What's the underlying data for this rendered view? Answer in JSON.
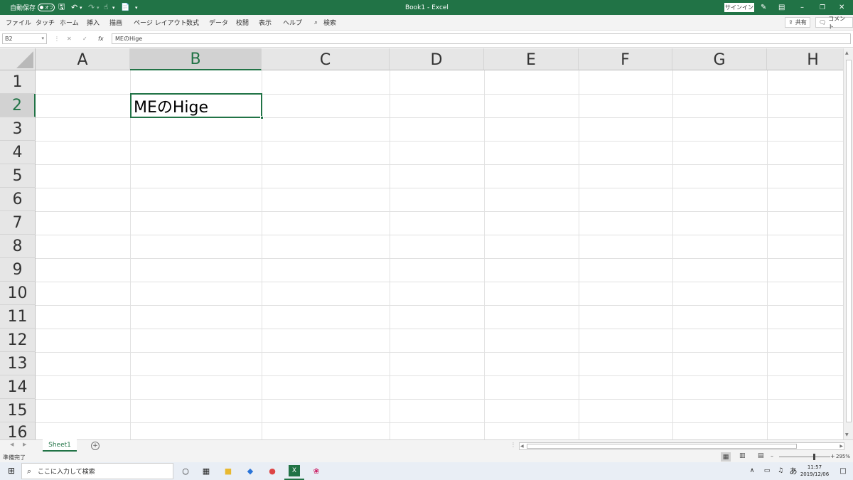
{
  "titlebar": {
    "autosave_label": "自動保存",
    "autosave_state": "オフ",
    "title": "Book1  -  Excel",
    "signin_label": "サインイン"
  },
  "ribbon": {
    "tabs": [
      "ファイル",
      "タッチ",
      "ホーム",
      "挿入",
      "描画",
      "ページ レイアウト",
      "数式",
      "データ",
      "校閲",
      "表示",
      "ヘルプ"
    ],
    "search_label": "検索",
    "share_label": "共有",
    "comment_label": "コメント"
  },
  "formula_bar": {
    "name_box": "B2",
    "fx_label": "fx",
    "value": "MEのHige"
  },
  "grid": {
    "columns": [
      "A",
      "B",
      "C",
      "D",
      "E",
      "F",
      "G",
      "H"
    ],
    "rows": [
      "1",
      "2",
      "3",
      "4",
      "5",
      "6",
      "7",
      "8",
      "9",
      "10",
      "11",
      "12",
      "13",
      "14",
      "15",
      "16"
    ],
    "selected_column": "B",
    "selected_row": "2",
    "active_cell_value": "MEのHige"
  },
  "sheets": {
    "tabs": [
      "Sheet1"
    ],
    "add_symbol": "+"
  },
  "status": {
    "ready_label": "準備完了",
    "zoom": "295%"
  },
  "taskbar": {
    "search_placeholder": "ここに入力して検索",
    "ime_label": "あ",
    "time": "11:57",
    "date": "2019/12/06"
  },
  "colors": {
    "accent": "#217346"
  }
}
